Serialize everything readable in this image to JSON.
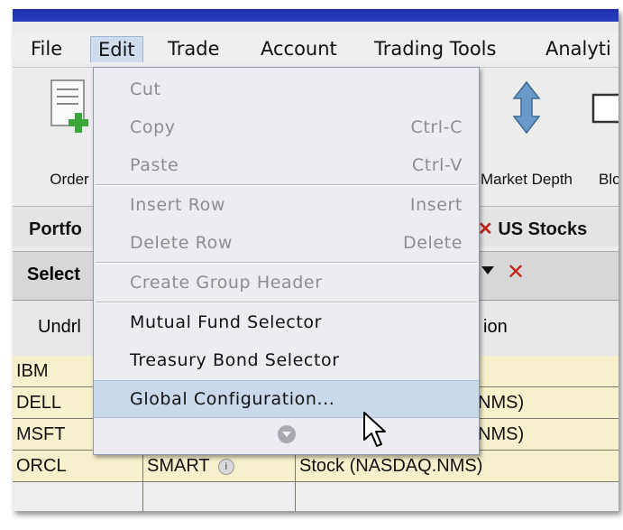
{
  "menubar": {
    "items": [
      {
        "label": "File"
      },
      {
        "label": "Edit"
      },
      {
        "label": "Trade"
      },
      {
        "label": "Account"
      },
      {
        "label": "Trading Tools"
      },
      {
        "label": "Analyti"
      }
    ]
  },
  "toolbar": {
    "order_label": "Order",
    "market_depth_label": "Market Depth",
    "partial_label": "Blo"
  },
  "tabs": {
    "portfolio": "Portfo",
    "us_stocks": "US Stocks"
  },
  "select_bar": {
    "label": "Select"
  },
  "columns": {
    "underlying": "Undrl",
    "description_partial": "ion"
  },
  "grid": {
    "rows": [
      {
        "symbol": "IBM",
        "exchange": "",
        "type": ""
      },
      {
        "symbol": "DELL",
        "exchange": "",
        "type": "NMS)"
      },
      {
        "symbol": "MSFT",
        "exchange": "",
        "type": "NMS)"
      },
      {
        "symbol": "ORCL",
        "exchange": "SMART",
        "type": "Stock (NASDAQ.NMS)"
      }
    ]
  },
  "edit_menu": {
    "items": [
      {
        "label": "Cut",
        "shortcut": ""
      },
      {
        "label": "Copy",
        "shortcut": "Ctrl-C"
      },
      {
        "label": "Paste",
        "shortcut": "Ctrl-V"
      },
      {
        "label": "Insert Row",
        "shortcut": "Insert"
      },
      {
        "label": "Delete Row",
        "shortcut": "Delete"
      },
      {
        "label": "Create Group Header",
        "shortcut": ""
      },
      {
        "label": "Mutual Fund Selector",
        "shortcut": ""
      },
      {
        "label": "Treasury Bond Selector",
        "shortcut": ""
      },
      {
        "label": "Global Configuration...",
        "shortcut": ""
      }
    ]
  },
  "colors": {
    "menu_highlight": "#c9d8ea",
    "grid_row": "#f7f0cc",
    "titlebar": "#1c2ea8",
    "close_x": "#c0261a"
  }
}
